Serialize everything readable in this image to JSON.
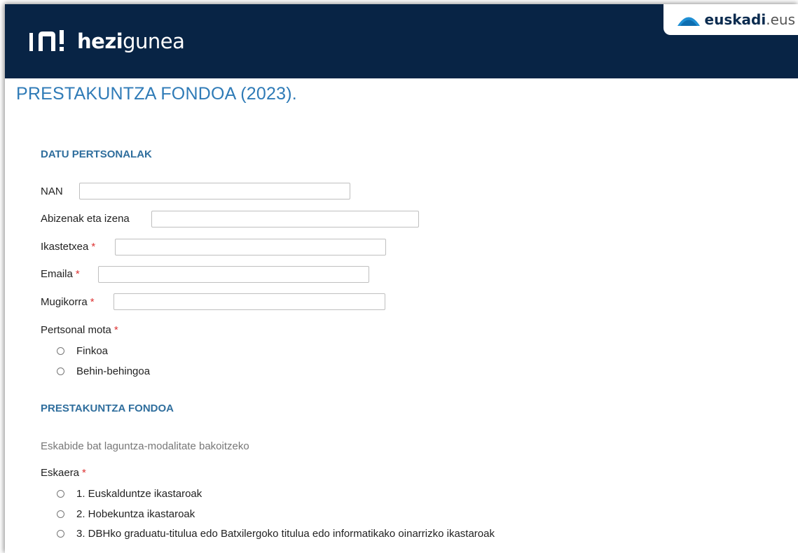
{
  "header": {
    "logo_bold": "hezi",
    "logo_light": "gunea",
    "gov_brand_bold": "euskadi",
    "gov_brand_light": ".eus",
    "bg_color": "#082445"
  },
  "page": {
    "title": "PRESTAKUNTZA FONDOA (2023)."
  },
  "personal_section": {
    "title": "DATU PERTSONALAK",
    "fields": [
      {
        "label": "NAN",
        "required": "",
        "value": ""
      },
      {
        "label": "Abizenak eta izena",
        "required": "",
        "value": ""
      },
      {
        "label": "Ikastetxea",
        "required": "*",
        "value": ""
      },
      {
        "label": "Emaila",
        "required": "*",
        "value": ""
      },
      {
        "label": "Mugikorra",
        "required": "*",
        "value": ""
      }
    ],
    "staff_type": {
      "label": "Pertsonal mota",
      "required": "*",
      "options": [
        "Finkoa",
        "Behin-behingoa"
      ]
    }
  },
  "fund_section": {
    "title": "PRESTAKUNTZA FONDOA",
    "hint": "Eskabide bat laguntza-modalitate bakoitzeko",
    "request": {
      "label": "Eskaera",
      "required": "*",
      "options": [
        "1. Euskalduntze ikastaroak",
        "2. Hobekuntza ikastaroak",
        "3. DBHko graduatu-titulua edo Batxilergoko titulua edo informatikako oinarrizko ikastaroak"
      ]
    }
  },
  "icons": {
    "site_logo": "hezigunea-logo-icon",
    "gov_logo": "euskadi-arc-icon"
  },
  "colors": {
    "accent": "#2f7bb7",
    "section": "#2f6e9d",
    "required": "#dd3333"
  }
}
